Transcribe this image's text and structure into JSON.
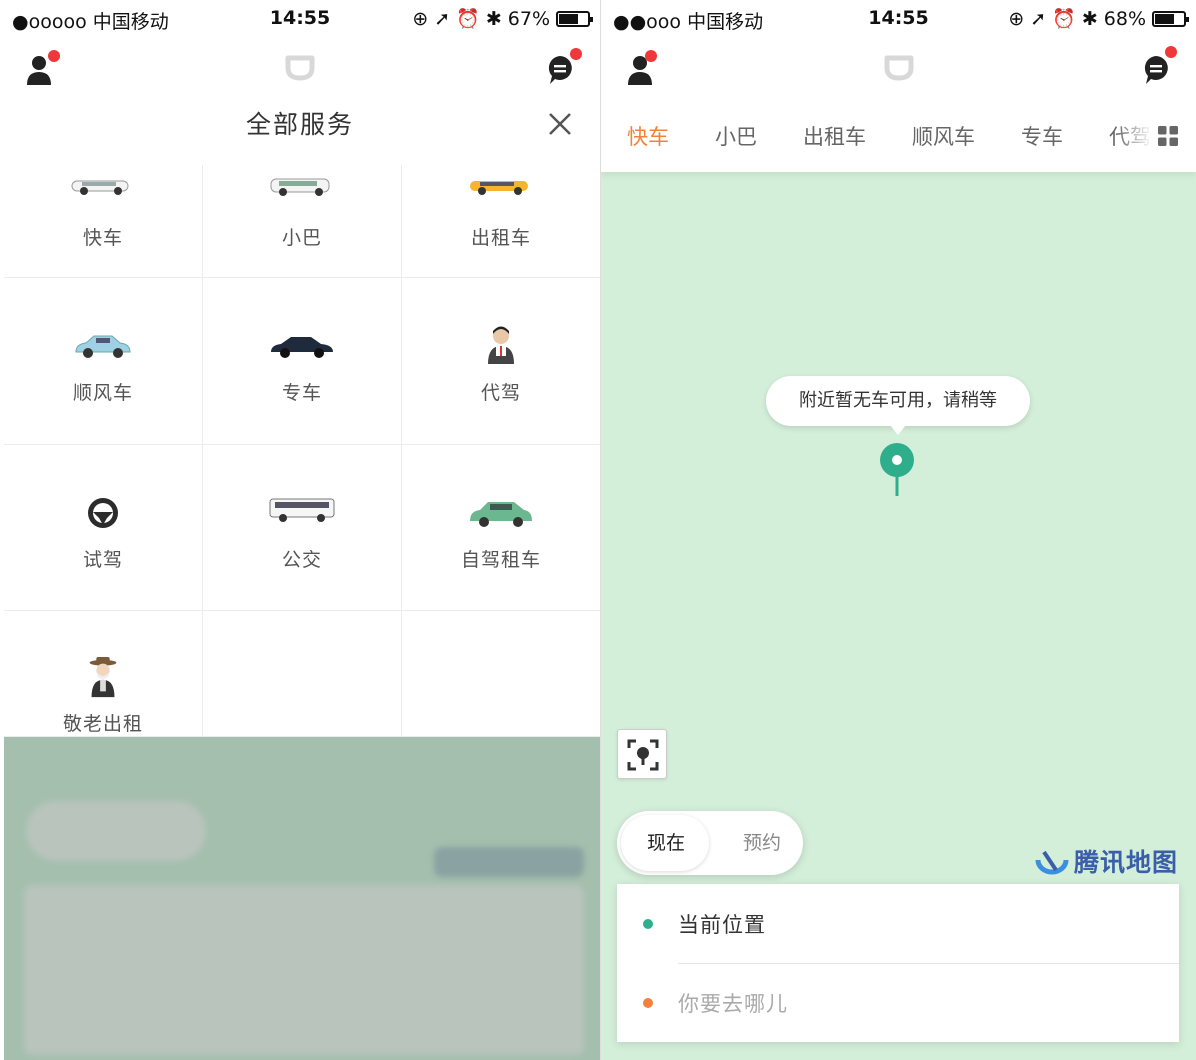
{
  "left": {
    "status": {
      "carrier": "●ooooo 中国移动",
      "time": "14:55",
      "battery": "67%",
      "battery_level": 0.67
    },
    "panel": {
      "title": "全部服务",
      "services": [
        {
          "label": "快车",
          "icon": "white-car-icon"
        },
        {
          "label": "小巴",
          "icon": "minibus-icon"
        },
        {
          "label": "出租车",
          "icon": "taxi-icon"
        },
        {
          "label": "顺风车",
          "icon": "blue-car-icon"
        },
        {
          "label": "专车",
          "icon": "black-car-icon"
        },
        {
          "label": "代驾",
          "icon": "chauffeur-icon"
        },
        {
          "label": "试驾",
          "icon": "steering-wheel-icon"
        },
        {
          "label": "公交",
          "icon": "bus-icon"
        },
        {
          "label": "自驾租车",
          "icon": "green-suv-icon"
        },
        {
          "label": "敬老出租",
          "icon": "elderly-man-icon"
        }
      ]
    }
  },
  "right": {
    "status": {
      "carrier": "●●ooo 中国移动",
      "time": "14:55",
      "battery": "68%",
      "battery_level": 0.68
    },
    "tabs": [
      {
        "label": "快车",
        "active": true
      },
      {
        "label": "小巴",
        "active": false
      },
      {
        "label": "出租车",
        "active": false
      },
      {
        "label": "顺风车",
        "active": false
      },
      {
        "label": "专车",
        "active": false
      },
      {
        "label": "代驾",
        "active": false
      }
    ],
    "map": {
      "bubble_text": "附近暂无车可用，请稍等",
      "brand": "腾讯地图"
    },
    "time_switch": {
      "now": "现在",
      "later": "预约"
    },
    "address": {
      "from": "当前位置",
      "to_placeholder": "你要去哪儿"
    },
    "colors": {
      "accent": "#f2813b",
      "green": "#2fae8c",
      "map_bg": "#d3eed9",
      "badge": "#f0383b"
    }
  }
}
